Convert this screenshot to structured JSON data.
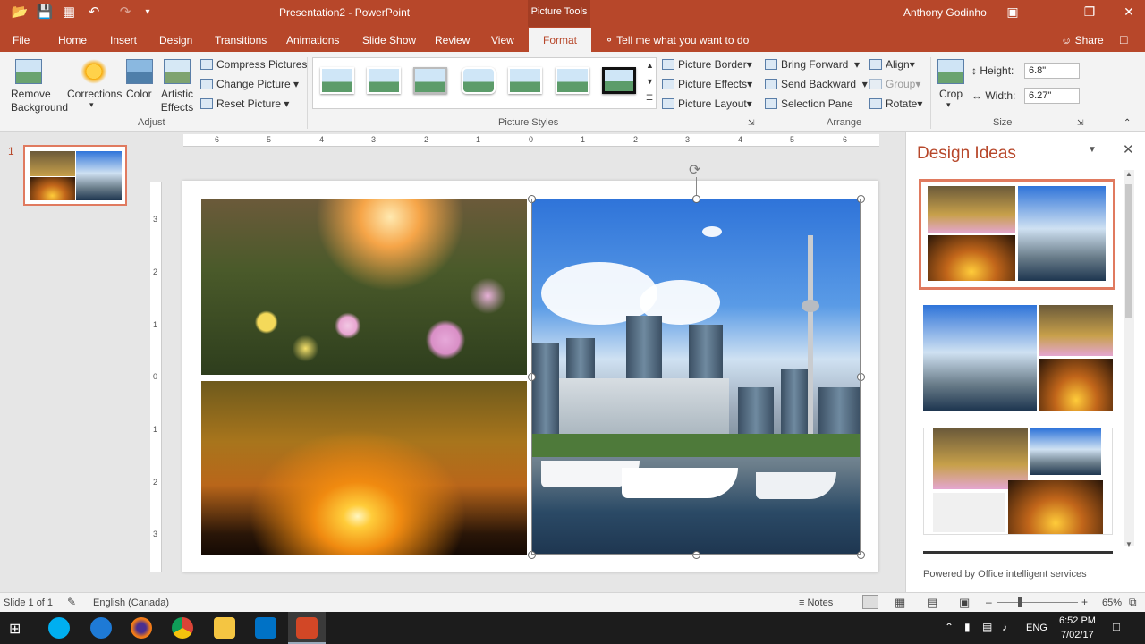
{
  "titlebar": {
    "title": "Presentation2 - PowerPoint",
    "context_tab_group": "Picture Tools",
    "user": "Anthony Godinho"
  },
  "tabs": [
    "File",
    "Home",
    "Insert",
    "Design",
    "Transitions",
    "Animations",
    "Slide Show",
    "Review",
    "View"
  ],
  "active_tab": "Format",
  "tell_me": "Tell me what you want to do",
  "share": "Share",
  "ribbon": {
    "remove_background": "Remove Background",
    "corrections": "Corrections",
    "color": "Color",
    "artistic_effects": "Artistic Effects",
    "compress": "Compress Pictures",
    "change": "Change Picture",
    "reset": "Reset Picture",
    "group_adjust": "Adjust",
    "group_styles": "Picture Styles",
    "border": "Picture Border",
    "effects": "Picture Effects",
    "layout": "Picture Layout",
    "bring_forward": "Bring Forward",
    "send_backward": "Send Backward",
    "selection_pane": "Selection Pane",
    "align": "Align",
    "group": "Group",
    "rotate": "Rotate",
    "group_arrange": "Arrange",
    "crop": "Crop",
    "height_label": "Height:",
    "height_value": "6.8\"",
    "width_label": "Width:",
    "width_value": "6.27\"",
    "group_size": "Size"
  },
  "ruler": {
    "horizontal": [
      "6",
      "5",
      "4",
      "3",
      "2",
      "1",
      "0",
      "1",
      "2",
      "3",
      "4",
      "5",
      "6"
    ],
    "vertical": [
      "3",
      "2",
      "1",
      "0",
      "1",
      "2",
      "3"
    ]
  },
  "slide_panel": {
    "slide_number": "1"
  },
  "design_pane": {
    "title": "Design Ideas",
    "footer": "Powered by Office intelligent services"
  },
  "status": {
    "slide": "Slide 1 of 1",
    "language": "English (Canada)",
    "notes": "Notes",
    "zoom": "65%"
  },
  "taskbar": {
    "lang": "ENG",
    "time": "6:52 PM",
    "date": "7/02/17"
  },
  "colors": {
    "accent": "#b7472a",
    "ribbon_bg": "#f3f3f3",
    "taskbar": "#1c1c1c"
  }
}
